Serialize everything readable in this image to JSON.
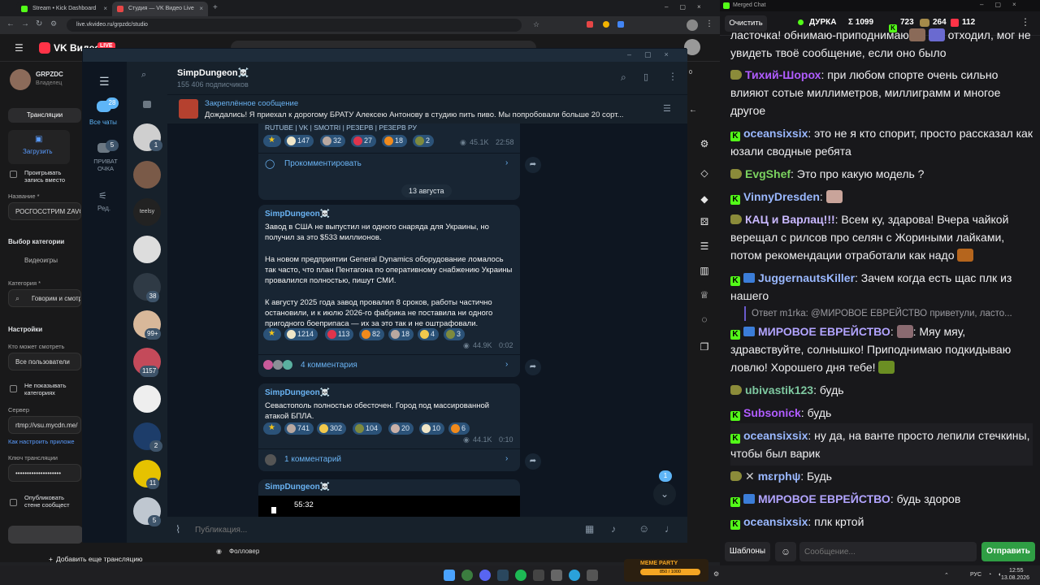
{
  "browser": {
    "tabs": [
      {
        "title": "Stream • Kick Dashboard",
        "color": "#53fc18"
      },
      {
        "title": "Студия — VK Видео Live",
        "color": "#e64646"
      }
    ],
    "url": "live.vkvideo.ru/grpzdc/studio"
  },
  "vk": {
    "logo": "VK Видео",
    "logo_badge": "LIVE",
    "channel_name": "GRPZDC",
    "channel_role": "Владелец",
    "nav_broadcasts": "Трансляции",
    "upload_label": "Загрузить",
    "preview_checkbox": "Проигрывать запись вместо обложки",
    "name_label": "Название *",
    "name_value": "РОСГОССТРИМ ZAVO",
    "category_section": "Выбор категории",
    "category_tab": "Видеоигры",
    "category_label": "Категория *",
    "category_value": "Говорим и смотр",
    "settings_title": "Настройки",
    "who_can_watch": "Кто может смотреть",
    "who_value": "Все пользователи",
    "hide_categories": "Не показывать категориях",
    "server_label": "Сервер",
    "server_value": "rtmp://vsu.mycdn.me/",
    "howto_link": "Как настроить приложе",
    "key_label": "Ключ трансляции",
    "key_value": "••••••••••••••••••••",
    "publish_wall": "Опубликовать стене сообщест",
    "add_broadcast": "Добавить еще трансляцию",
    "follower_event": "Фолловер"
  },
  "telegram": {
    "nav": [
      {
        "label": "Все чаты",
        "badge": "28"
      },
      {
        "label": "ПРИВАТ ОЧКА",
        "badge": "5"
      },
      {
        "label": "Ред.",
        "badge": ""
      }
    ],
    "chat_badges": [
      "1",
      "",
      "",
      "",
      "38",
      "99+",
      "1157",
      "",
      "2",
      "11",
      "5"
    ],
    "channel_title": "SimpDungeon☠️",
    "subscribers": "155 406 подписчиков",
    "pinned_title": "Закреплённое сообщение",
    "pinned_text": "Дождались!  Я приехал к дорогому БРАТУ Алексею Антонову в студию пить пиво. Мы попробовали больше 20 сорт...",
    "top_links": "RUTUBE | VK | SMOTRI | РЕЗЕРВ | РЕЗЕРВ РУ",
    "top_reactions": [
      "147",
      "32",
      "27",
      "18",
      "2"
    ],
    "top_views": "45.1K",
    "top_time": "22:58",
    "comment_cta": "Прокомментировать",
    "date_divider": "13 августа",
    "post1": {
      "author": "SimpDungeon☠️",
      "p1": "Завод в США не выпустил ни одного снаряда для Украины, но получил за это $533 миллионов.",
      "p2": "На новом предприятии General Dynamics оборудование ломалось так часто, что план Пентагона по оперативному снабжению Украины провалился полностью, пишут СМИ.",
      "p3": "К августу 2025 года завод провалил 8 сроков, работы частично остановили, и к июлю 2026-го фабрика не поставила ни одного пригодного боеприпаса — их за это так и не оштрафовали.",
      "reactions": [
        "1214",
        "113",
        "82",
        "18",
        "4",
        "3"
      ],
      "views": "44.9K",
      "time": "0:02",
      "comments": "4 комментария"
    },
    "post2": {
      "author": "SimpDungeon☠️",
      "text": "Севастополь полностью обесточен. Город под массированной атакой БПЛА.",
      "reactions": [
        "741",
        "302",
        "104",
        "20",
        "10",
        "6"
      ],
      "views": "44.1K",
      "time": "0:10",
      "comments": "1 комментарий"
    },
    "post3": {
      "author": "SimpDungeon☠️",
      "video_time": "55:32"
    },
    "unread_badge": "1",
    "composer_placeholder": "Публикация..."
  },
  "merged_chat": {
    "window_title": "Merged Chat",
    "clear_label": "Очистить",
    "stream_name": "ДУРКА",
    "stat_total": "Σ 1099",
    "stat_kick": "723",
    "stat_twitch": "264",
    "stat_other": "112",
    "messages": [
      {
        "nick": "",
        "text": "ласточка! обнимаю-приподнимаю",
        "text2": "отходил, мог не увидеть твоё сообщение, если оно было",
        "color": "#efeff1"
      },
      {
        "nick": "Тихий-Шорох",
        "text": ": при любом спорте очень сильно влияют сотые миллиметров, миллиграмм и многое другое",
        "color": "#b05cff"
      },
      {
        "nick": "oceansixsix",
        "text": ": это не я кто спорит, просто рассказал как юзали сводные ребята",
        "color": "#9ab8ff"
      },
      {
        "nick": "EvgShef",
        "text": ": Это про какую модель ?",
        "color": "#7bd35f"
      },
      {
        "nick": "VinnyDresden",
        "text": ":",
        "color": "#9ab8ff"
      },
      {
        "nick": "КАЦ и Варлац!!!",
        "text": ": Всем ку, здарова! Вчера чайкой верещал с рилсов про селян с Жориными лайками, потом рекомендации отработали как надо",
        "color": "#c9b8ff"
      },
      {
        "nick": "JuggernautsKiller",
        "text": ": Зачем когда есть щас плк из нашего",
        "color": "#9ab8ff"
      },
      {
        "reply": "Ответ m1rka: @МИРОВОЕ ЕВРЕЙСТВО приветули, ласто..."
      },
      {
        "nick": "МИРОВОЕ ЕВРЕЙСТВО",
        "text": ": Мяу мяу, здравствуйте, солнышко! Приподнимаю подкидываю ловлю! Хорошего дня тебе!",
        "color": "#b2a4ff"
      },
      {
        "nick": "ubivastik123",
        "text": ": будь",
        "color": "#7ec8a0"
      },
      {
        "nick": "Subsonick",
        "text": ": будь",
        "color": "#b05cff"
      },
      {
        "nick": "oceansixsix",
        "text": ": ну да, на ванте просто лепили стечкины, чтобы был варик",
        "color": "#9ab8ff"
      },
      {
        "nick": "mɛrphψ",
        "text": ": Будь",
        "color": "#9ab8ff"
      },
      {
        "nick": "МИРОВОЕ ЕВРЕЙСТВО",
        "text": ": будь здоров",
        "color": "#b2a4ff"
      },
      {
        "nick": "oceansixsix",
        "text": ": плк кртой",
        "color": "#9ab8ff"
      }
    ],
    "templates_label": "Шаблоны",
    "input_placeholder": "Сообщение...",
    "send_label": "Отправить"
  },
  "taskbar": {
    "meme_party": "MEME PARTY",
    "meme_score": "850 / 1000",
    "lang": "РУС",
    "time": "12:55",
    "date": "13.08.2026"
  }
}
